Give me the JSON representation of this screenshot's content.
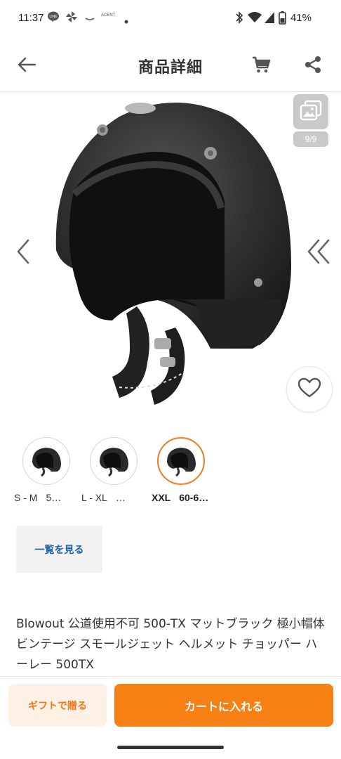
{
  "status_bar": {
    "time": "11:37",
    "battery": "41%",
    "icons": [
      "line-icon",
      "pinwheel-icon",
      "app-icon",
      "acent-icon",
      "dot-icon",
      "bluetooth-icon",
      "wifi-icon",
      "signal-icon",
      "battery-icon"
    ],
    "acent_label": "ACENT"
  },
  "header": {
    "title": "商品詳細",
    "icons": [
      "back-arrow-icon",
      "cart-icon",
      "share-icon"
    ]
  },
  "gallery": {
    "counter": "9/9",
    "icons": [
      "gallery-icon",
      "chevron-left-icon",
      "double-chevron-right-icon",
      "heart-icon"
    ]
  },
  "variants": [
    {
      "size": "S - M",
      "range": "5…",
      "selected": false
    },
    {
      "size": "L - XL",
      "range": "…",
      "selected": false
    },
    {
      "size": "XXL",
      "range": "60-6…",
      "selected": true
    }
  ],
  "view_all_label": "一覧を見る",
  "product_title": "Blowout 公道使用不可 500-TX マットブラック 極小帽体 ビンテージ スモールジェット ヘルメット チョッパー ハーレー 500TX",
  "actions": {
    "gift_label": "ギフトで贈る",
    "cart_label": "カートに入れる"
  },
  "colors": {
    "accent": "#f68014",
    "accent_light": "#fdf1e6",
    "link": "#2262a8",
    "selected_border": "#f07b1a"
  }
}
